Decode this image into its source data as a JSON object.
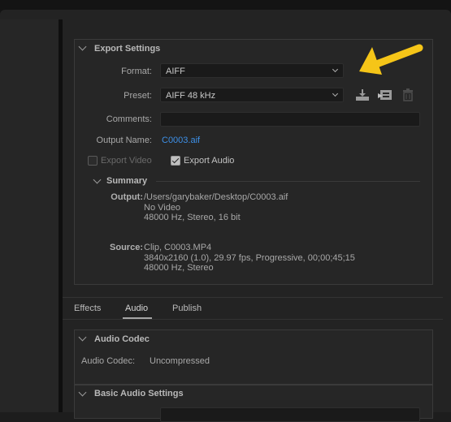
{
  "export_settings": {
    "title": "Export Settings",
    "format_label": "Format:",
    "format_value": "AIFF",
    "preset_label": "Preset:",
    "preset_value": "AIFF 48 kHz",
    "comments_label": "Comments:",
    "comments_value": "",
    "output_name_label": "Output Name:",
    "output_name_value": "C0003.aif",
    "export_video_label": "Export Video",
    "export_video_checked": false,
    "export_audio_label": "Export Audio",
    "export_audio_checked": true,
    "preset_icons": [
      "save-preset-icon",
      "import-preset-icon",
      "delete-preset-icon"
    ]
  },
  "summary": {
    "title": "Summary",
    "output_label": "Output:",
    "output_lines": [
      "/Users/garybaker/Desktop/C0003.aif",
      "No Video",
      "48000 Hz, Stereo, 16 bit"
    ],
    "source_label": "Source:",
    "source_lines": [
      "Clip, C0003.MP4",
      "3840x2160 (1.0), 29.97 fps, Progressive, 00;00;45;15",
      "48000 Hz, Stereo"
    ]
  },
  "tabs": [
    {
      "label": "Effects",
      "active": false
    },
    {
      "label": "Audio",
      "active": true
    },
    {
      "label": "Publish",
      "active": false
    }
  ],
  "audio_codec": {
    "title": "Audio Codec",
    "codec_label": "Audio Codec:",
    "codec_value": "Uncompressed"
  },
  "basic_audio": {
    "title": "Basic Audio Settings"
  },
  "annotation": {
    "arrow_color": "#f5c518"
  }
}
